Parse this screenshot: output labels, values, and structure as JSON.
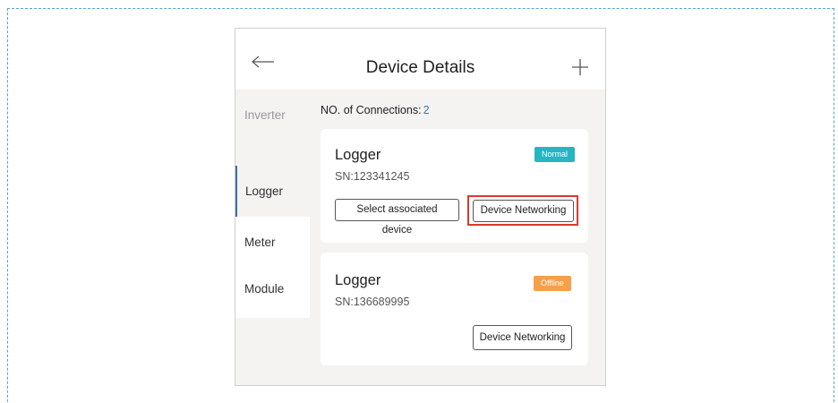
{
  "header": {
    "title": "Device Details"
  },
  "sidebar": {
    "items": [
      {
        "label": "Inverter"
      },
      {
        "label": "Logger"
      },
      {
        "label": "Meter"
      },
      {
        "label": "Module"
      }
    ],
    "selected": "Logger"
  },
  "connections": {
    "label": "NO.  of Connections:",
    "count": "2"
  },
  "devices": [
    {
      "name": "Logger",
      "sn": "SN:123341245",
      "status": "Normal",
      "status_color": "#27b5c4",
      "buttons": [
        {
          "label": "Select associated device"
        },
        {
          "label": "Device Networking"
        }
      ]
    },
    {
      "name": "Logger",
      "sn": "SN:136689995",
      "status": "Offline",
      "status_color": "#f5a04a",
      "buttons": [
        {
          "label": "Device  Networking"
        }
      ]
    }
  ],
  "colors": {
    "accent": "#3a6fa8",
    "link": "#3a78c2",
    "highlight": "#d83a2c",
    "page_bg": "#f4f3f2"
  },
  "icons": {
    "back": "arrow-left-icon",
    "add": "plus-icon"
  }
}
